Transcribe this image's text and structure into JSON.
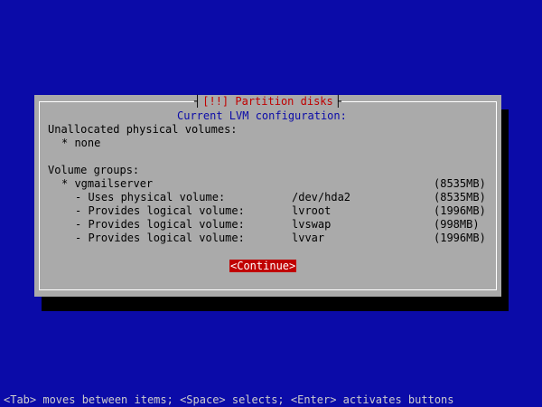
{
  "dialog": {
    "title": "[!!] Partition disks",
    "subtitle": "Current LVM configuration:",
    "unallocated_heading": "Unallocated physical volumes:",
    "unallocated_items": [
      "* none"
    ],
    "volume_groups_heading": "Volume groups:",
    "volume_group": {
      "name": "* vgmailserver",
      "size": "(8535MB)"
    },
    "rows": [
      {
        "label": "- Uses physical volume:",
        "value": "/dev/hda2",
        "size": "(8535MB)"
      },
      {
        "label": "- Provides logical volume:",
        "value": "lvroot",
        "size": "(1996MB)"
      },
      {
        "label": "- Provides logical volume:",
        "value": "lvswap",
        "size": "(998MB)"
      },
      {
        "label": "- Provides logical volume:",
        "value": "lvvar",
        "size": "(1996MB)"
      }
    ],
    "continue_label": "<Continue>"
  },
  "footer": {
    "hint": "<Tab> moves between items; <Space> selects; <Enter> activates buttons"
  },
  "colors": {
    "background": "#0b0ba8",
    "dialog": "#aaaaaa",
    "title": "#c00000",
    "button_bg": "#c00000",
    "button_fg": "#ffffff"
  }
}
